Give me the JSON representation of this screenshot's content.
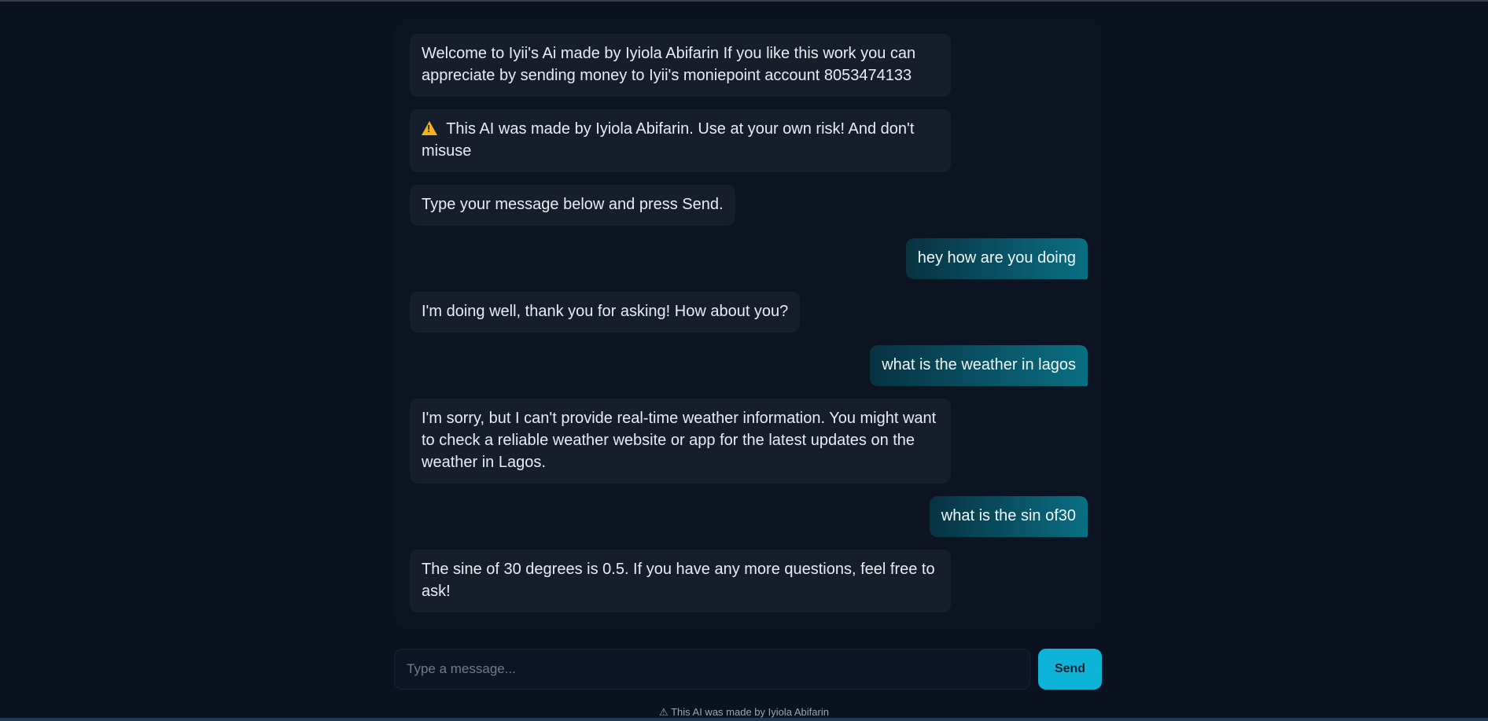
{
  "colors": {
    "background": "#0a1220",
    "panel": "#0c1422",
    "bot_bubble": "#161d2b",
    "user_bubble_start": "#073241",
    "user_bubble_end": "#0a6f82",
    "send_button": "#0db4d8",
    "warning": "#f2b21b"
  },
  "chat": {
    "messages": [
      {
        "role": "bot",
        "text": "Welcome to Iyii's Ai made by Iyiola Abifarin If you like this work you can appreciate by sending money to Iyii's moniepoint account 8053474133"
      },
      {
        "role": "bot",
        "icon": "warning-icon",
        "text": "This AI was made by Iyiola Abifarin. Use at your own risk! And don't misuse"
      },
      {
        "role": "bot",
        "text": "Type your message below and press Send."
      },
      {
        "role": "user",
        "text": "hey how are you doing"
      },
      {
        "role": "bot",
        "text": "I'm doing well, thank you for asking! How about you?"
      },
      {
        "role": "user",
        "text": "what is the weather in lagos"
      },
      {
        "role": "bot",
        "text": "I'm sorry, but I can't provide real-time weather information. You might want to check a reliable weather website or app for the latest updates on the weather in Lagos."
      },
      {
        "role": "user",
        "text": "what is the sin of30"
      },
      {
        "role": "bot",
        "text": "The sine of 30 degrees is 0.5. If you have any more questions, feel free to ask!"
      }
    ]
  },
  "composer": {
    "placeholder": "Type a message...",
    "value": "",
    "send_label": "Send"
  },
  "footer": {
    "text": "⚠ This AI was made by Iyiola Abifarin"
  }
}
